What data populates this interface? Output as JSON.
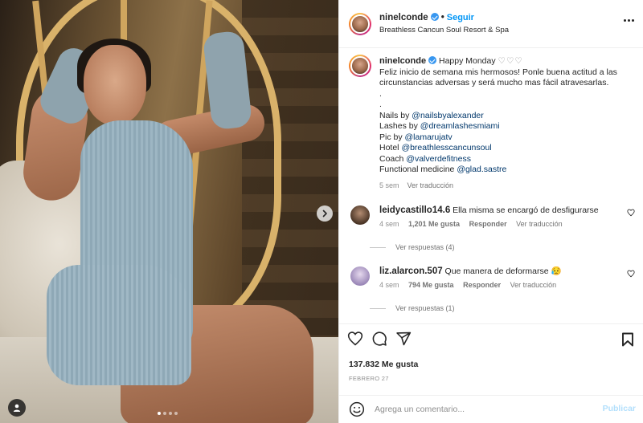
{
  "post": {
    "author": "ninelconde",
    "follow_label": "Seguir",
    "location": "Breathless Cancun Soul Resort & Spa",
    "carousel_dots": 4
  },
  "caption": {
    "username": "ninelconde",
    "title": "Happy Monday",
    "hearts": "♡♡♡",
    "text": "Feliz inicio de semana mis hermosos! Ponle buena actitud a las circunstancias adversas y será mucho mas fácil atravesarlas.",
    "dot1": ".",
    "dot2": ".",
    "credits": [
      {
        "label": "Nails by",
        "handle": "@nailsbyalexander"
      },
      {
        "label": "Lashes by",
        "handle": "@dreamlashesmiami"
      },
      {
        "label": "Pic by",
        "handle": "@lamarujatv"
      },
      {
        "label": "Hotel",
        "handle": "@breathlesscancunsoul"
      },
      {
        "label": "Coach",
        "handle": "@valverdefitness"
      },
      {
        "label": "Functional medicine",
        "handle": "@glad.sastre"
      }
    ],
    "time": "5 sem",
    "translate": "Ver traducción"
  },
  "comments": [
    {
      "username": "leidycastillo14.6",
      "text": "Ella misma se encargó de desfigurarse",
      "time": "4 sem",
      "likes": "1,201 Me gusta",
      "reply": "Responder",
      "translate": "Ver traducción",
      "replies": "Ver respuestas (4)"
    },
    {
      "username": "liz.alarcon.507",
      "text": "Que manera de deformarse 😥",
      "time": "4 sem",
      "likes": "794 Me gusta",
      "reply": "Responder",
      "translate": "Ver traducción",
      "replies": "Ver respuestas (1)"
    }
  ],
  "stats": {
    "likes": "137.832 Me gusta",
    "date": "FEBRERO 27"
  },
  "composer": {
    "placeholder": "Agrega un comentario...",
    "publish": "Publicar"
  },
  "colors": {
    "link": "#00376b",
    "follow": "#0095f6",
    "publish_disabled": "#b2dffc",
    "verified": "#3897f0"
  }
}
